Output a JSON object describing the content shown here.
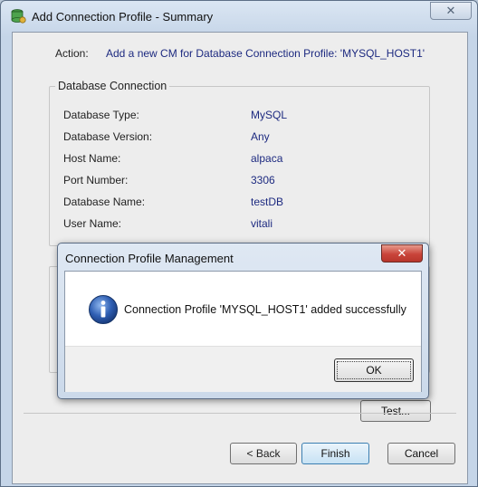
{
  "window": {
    "title": "Add Connection Profile - Summary",
    "close_glyph": "✕"
  },
  "action": {
    "label": "Action:",
    "value": "Add a new CM for Database Connection Profile: 'MYSQL_HOST1'"
  },
  "database_connection": {
    "legend": "Database Connection",
    "rows": [
      {
        "label": "Database Type:",
        "value": "MySQL"
      },
      {
        "label": "Database Version:",
        "value": "Any"
      },
      {
        "label": "Host Name:",
        "value": "alpaca"
      },
      {
        "label": "Port Number:",
        "value": "3306"
      },
      {
        "label": "Database Name:",
        "value": "testDB"
      },
      {
        "label": "User Name:",
        "value": "vitali"
      }
    ]
  },
  "buttons": {
    "test": "Test...",
    "back": "< Back",
    "finish": "Finish",
    "cancel": "Cancel"
  },
  "dialog": {
    "title": "Connection Profile Management",
    "close_glyph": "✕",
    "message": "Connection Profile 'MYSQL_HOST1' added successfully",
    "ok": "OK",
    "icon": "info-icon"
  },
  "colors": {
    "value_text": "#1d2a80",
    "dialog_close": "#c9443a",
    "info_icon": "#2f5fb3"
  }
}
